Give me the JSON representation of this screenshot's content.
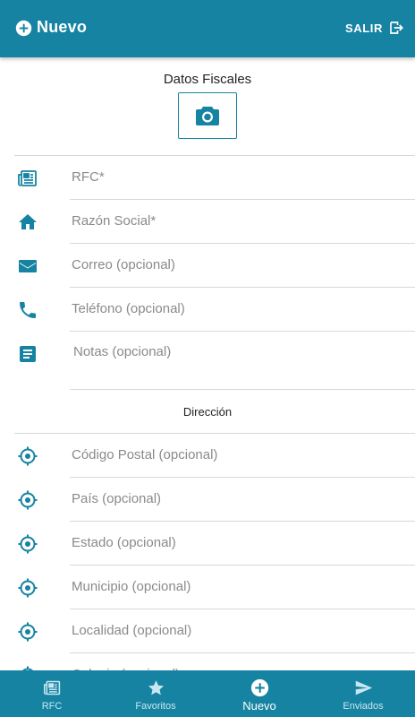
{
  "app_bar": {
    "title": "Nuevo",
    "logout_label": "SALIR"
  },
  "fiscal": {
    "section_title": "Datos Fiscales",
    "fields": [
      {
        "placeholder": "RFC*",
        "icon": "newspaper-icon"
      },
      {
        "placeholder": "Razón Social*",
        "icon": "home-icon"
      },
      {
        "placeholder": "Correo (opcional)",
        "icon": "mail-icon"
      },
      {
        "placeholder": "Teléfono (opcional)",
        "icon": "phone-icon"
      },
      {
        "placeholder": "Notas (opcional)",
        "icon": "notes-icon"
      }
    ]
  },
  "address": {
    "section_title": "Dirección",
    "fields": [
      {
        "placeholder": "Código Postal (opcional)",
        "icon": "location-target-icon"
      },
      {
        "placeholder": "País (opcional)",
        "icon": "location-target-icon"
      },
      {
        "placeholder": "Estado (opcional)",
        "icon": "location-target-icon"
      },
      {
        "placeholder": "Municipio (opcional)",
        "icon": "location-target-icon"
      },
      {
        "placeholder": "Localidad (opcional)",
        "icon": "location-target-icon"
      },
      {
        "placeholder": "Colonia (opcional)",
        "icon": "location-target-icon"
      }
    ]
  },
  "bottom_nav": {
    "items": [
      {
        "label": "RFC",
        "icon": "newspaper-icon",
        "active": false
      },
      {
        "label": "Favoritos",
        "icon": "star-icon",
        "active": false
      },
      {
        "label": "Nuevo",
        "icon": "add-circle-icon",
        "active": true
      },
      {
        "label": "Enviados",
        "icon": "send-icon",
        "active": false
      }
    ]
  },
  "colors": {
    "primary": "#1683a3",
    "icon": "#1683a3",
    "divider": "#d8d8d8",
    "placeholder": "#8a8a8a"
  }
}
